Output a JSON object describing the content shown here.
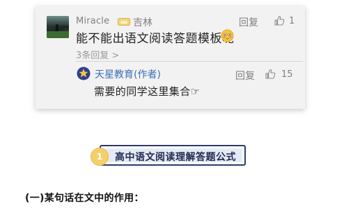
{
  "comment": {
    "username": "Miracle",
    "nickname": "吉林",
    "reply_label": "回复",
    "like_count": "1",
    "text": "能不能出语文阅读答题模板呢",
    "replies_link": "3条回复 >"
  },
  "reply": {
    "author": "天星教育(作者)",
    "reply_label": "回复",
    "like_count": "15",
    "text": "需要的同学这里集合☞"
  },
  "section": {
    "number": "1",
    "title": "高中语文阅读理解答题公式"
  },
  "subheading": "(一)某句话在文中的作用："
}
